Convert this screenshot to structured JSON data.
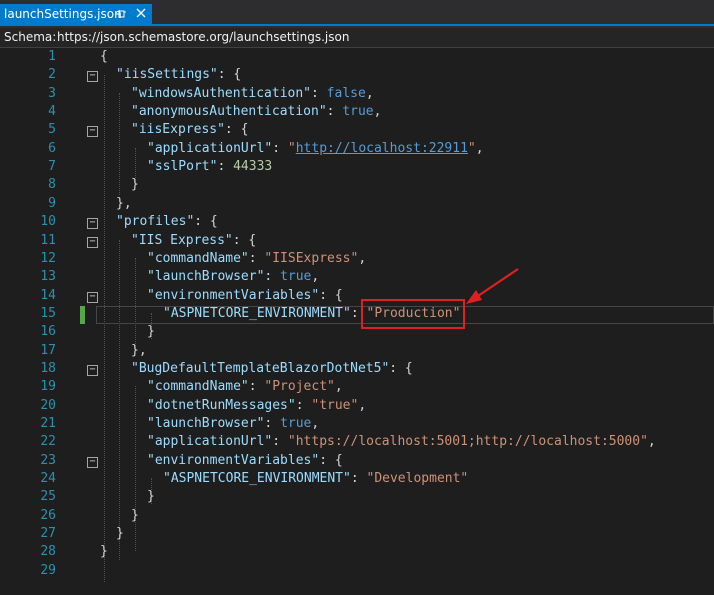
{
  "tab": {
    "title": "launchSettings.json",
    "pin_icon": "pin-icon",
    "close_icon": "close-icon"
  },
  "schema": {
    "label": "Schema:",
    "url": "https://json.schemastore.org/launchsettings.json"
  },
  "lines": [
    {
      "n": "1"
    },
    {
      "n": "2"
    },
    {
      "n": "3"
    },
    {
      "n": "4"
    },
    {
      "n": "5"
    },
    {
      "n": "6"
    },
    {
      "n": "7"
    },
    {
      "n": "8"
    },
    {
      "n": "9"
    },
    {
      "n": "10"
    },
    {
      "n": "11"
    },
    {
      "n": "12"
    },
    {
      "n": "13"
    },
    {
      "n": "14"
    },
    {
      "n": "15"
    },
    {
      "n": "16"
    },
    {
      "n": "17"
    },
    {
      "n": "18"
    },
    {
      "n": "19"
    },
    {
      "n": "20"
    },
    {
      "n": "21"
    },
    {
      "n": "22"
    },
    {
      "n": "23"
    },
    {
      "n": "24"
    },
    {
      "n": "25"
    },
    {
      "n": "26"
    },
    {
      "n": "27"
    },
    {
      "n": "28"
    },
    {
      "n": "29"
    }
  ],
  "code": {
    "l1": "{",
    "l2k": "\"iisSettings\"",
    "l2r": ": {",
    "l3k": "\"windowsAuthentication\"",
    "l3c": ": ",
    "l3v": "false",
    "l3e": ",",
    "l4k": "\"anonymousAuthentication\"",
    "l4c": ": ",
    "l4v": "true",
    "l4e": ",",
    "l5k": "\"iisExpress\"",
    "l5r": ": {",
    "l6k": "\"applicationUrl\"",
    "l6c": ": ",
    "l6q1": "\"",
    "l6v": "http://localhost:22911",
    "l6q2": "\"",
    "l6e": ",",
    "l7k": "\"sslPort\"",
    "l7c": ": ",
    "l7v": "44333",
    "l8": "}",
    "l9": "},",
    "l10k": "\"profiles\"",
    "l10r": ": {",
    "l11k": "\"IIS Express\"",
    "l11r": ": {",
    "l12k": "\"commandName\"",
    "l12c": ": ",
    "l12v": "\"IISExpress\"",
    "l12e": ",",
    "l13k": "\"launchBrowser\"",
    "l13c": ": ",
    "l13v": "true",
    "l13e": ",",
    "l14k": "\"environmentVariables\"",
    "l14r": ": {",
    "l15k": "\"ASPNETCORE_ENVIRONMENT\"",
    "l15c": ": ",
    "l15v": "\"Production\"",
    "l16": "}",
    "l17": "},",
    "l18k": "\"BugDefaultTemplateBlazorDotNet5\"",
    "l18r": ": {",
    "l19k": "\"commandName\"",
    "l19c": ": ",
    "l19v": "\"Project\"",
    "l19e": ",",
    "l20k": "\"dotnetRunMessages\"",
    "l20c": ": ",
    "l20v": "\"true\"",
    "l20e": ",",
    "l21k": "\"launchBrowser\"",
    "l21c": ": ",
    "l21v": "true",
    "l21e": ",",
    "l22k": "\"applicationUrl\"",
    "l22c": ": ",
    "l22v": "\"https://localhost:5001;http://localhost:5000\"",
    "l22e": ",",
    "l23k": "\"environmentVariables\"",
    "l23r": ": {",
    "l24k": "\"ASPNETCORE_ENVIRONMENT\"",
    "l24c": ": ",
    "l24v": "\"Development\"",
    "l25": "}",
    "l26": "}",
    "l27": "}",
    "l28": "}",
    "l29": ""
  },
  "folds": [
    "−",
    "−",
    "−",
    "−",
    "−",
    "−",
    "−",
    "−",
    "−"
  ],
  "colors": {
    "accent": "#007acc",
    "annotation": "#e02020",
    "changed_marker": "#57a64a"
  }
}
